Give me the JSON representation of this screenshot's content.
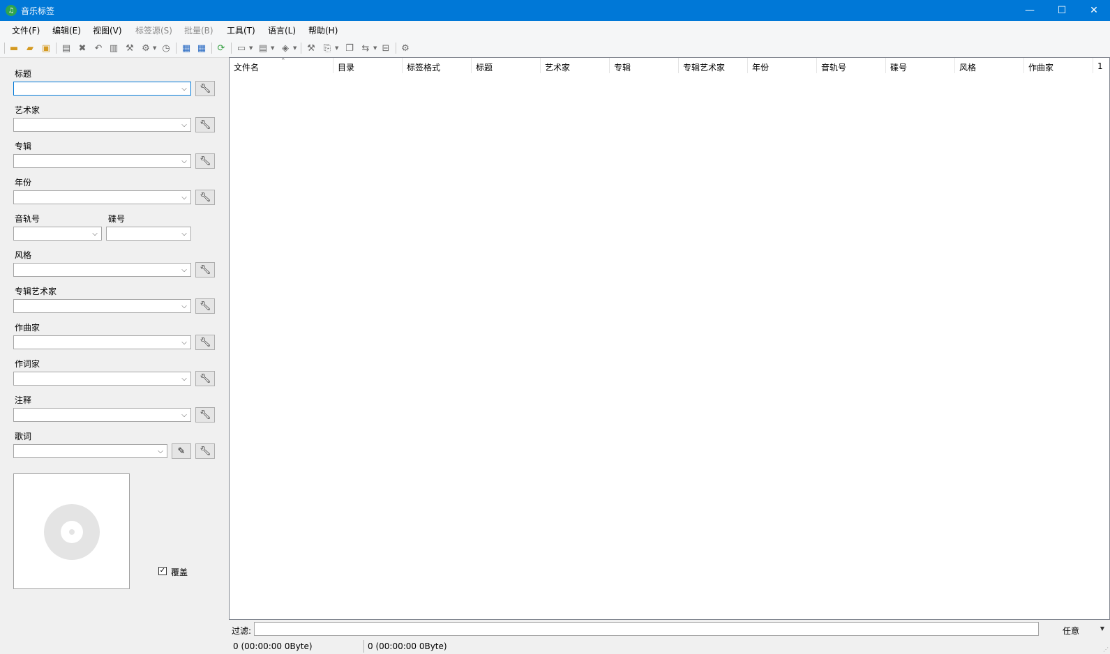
{
  "window": {
    "title": "音乐标签",
    "minimize": "—",
    "maximize": "☐",
    "close": "✕"
  },
  "menu": {
    "file": "文件(F)",
    "edit": "编辑(E)",
    "view": "视图(V)",
    "tag_source": "标签源(S)",
    "batch": "批量(B)",
    "tools": "工具(T)",
    "language": "语言(L)",
    "help": "帮助(H)"
  },
  "fields": {
    "title": "标题",
    "artist": "艺术家",
    "album": "专辑",
    "year": "年份",
    "track": "音轨号",
    "disc": "碟号",
    "genre": "风格",
    "album_artist": "专辑艺术家",
    "composer": "作曲家",
    "lyricist": "作词家",
    "comment": "注释",
    "lyrics": "歌词"
  },
  "cover": {
    "overwrite_label": "覆盖",
    "overwrite_checked": true,
    "check_glyph": "✓"
  },
  "columns": [
    "文件名",
    "目录",
    "标签格式",
    "标题",
    "艺术家",
    "专辑",
    "专辑艺术家",
    "年份",
    "音轨号",
    "碟号",
    "风格",
    "作曲家",
    "1"
  ],
  "filter": {
    "label": "过滤:",
    "value": "",
    "mode": "任意"
  },
  "status": {
    "left": "0 (00:00:00 0Byte)",
    "right": "0 (00:00:00 0Byte)"
  },
  "colors": {
    "titlebar": "#0078d7",
    "focus": "#0078d7"
  }
}
